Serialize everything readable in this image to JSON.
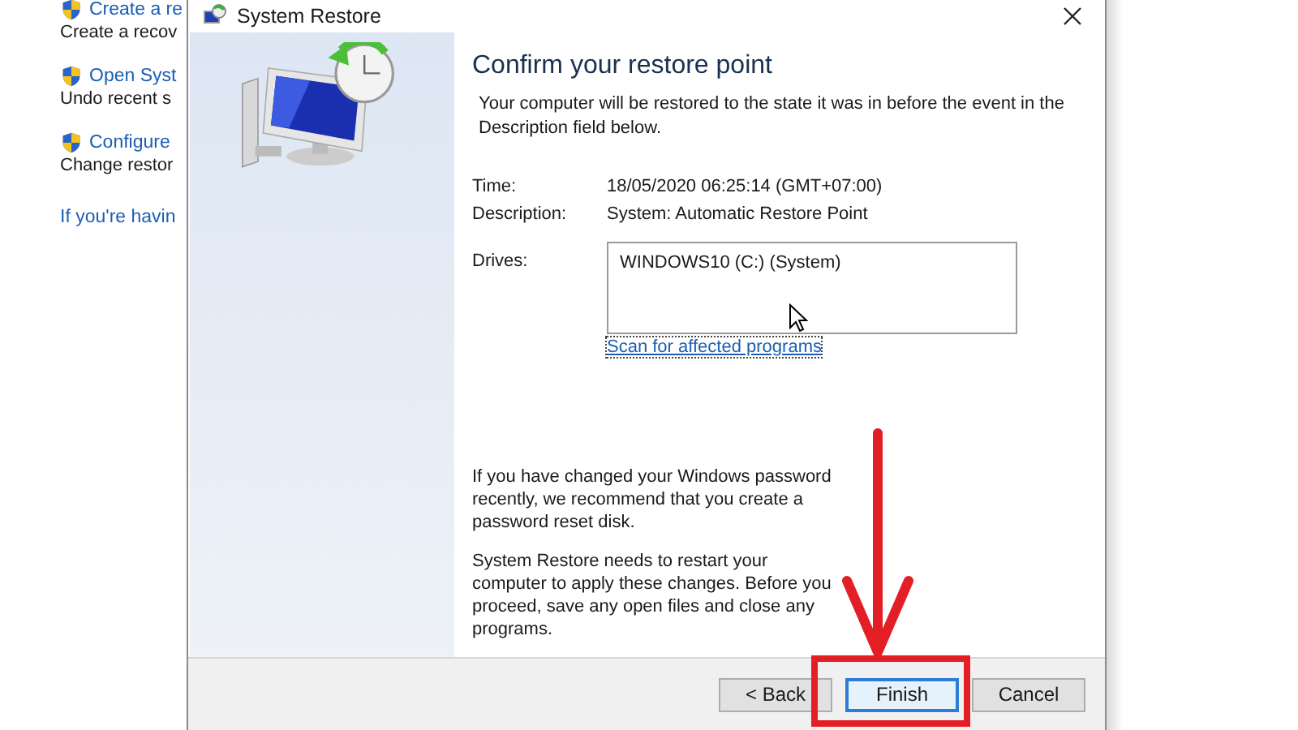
{
  "background_panel": {
    "tasks": [
      {
        "link": "Create a re",
        "description": "Create a recov"
      },
      {
        "link": "Open Syst",
        "description": "Undo recent s"
      },
      {
        "link": "Configure",
        "description": "Change restor"
      }
    ],
    "help_link": "If you're havin"
  },
  "window": {
    "title": "System Restore"
  },
  "heading": "Confirm your restore point",
  "intro": "Your computer will be restored to the state it was in before the event in the Description field below.",
  "details": [
    {
      "label": "Time:",
      "value": "18/05/2020 06:25:14 (GMT+07:00)"
    },
    {
      "label": "Description:",
      "value": "System: Automatic Restore Point"
    }
  ],
  "drives": {
    "label": "Drives:",
    "items": [
      "WINDOWS10 (C:) (System)"
    ]
  },
  "scan_link": "Scan for affected programs",
  "notes": [
    "If you have changed your Windows password recently, we recommend that you create a password reset disk.",
    "System Restore needs to restart your computer to apply these changes. Before you proceed, save any open files and close any programs."
  ],
  "buttons": [
    {
      "label": "< Back",
      "default": false
    },
    {
      "label": "Finish",
      "default": true
    },
    {
      "label": "Cancel",
      "default": false
    }
  ]
}
